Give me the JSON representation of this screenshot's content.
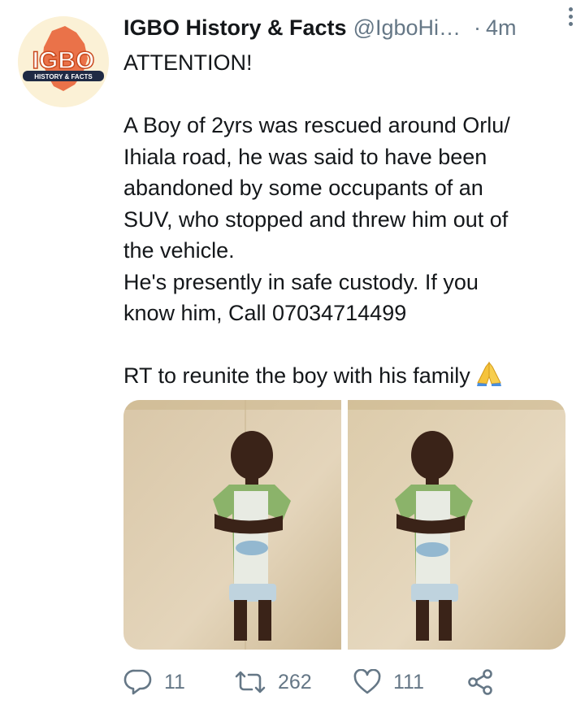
{
  "tweet": {
    "author": {
      "name": "IGBO History & Facts",
      "handle": "@IgboHi…",
      "avatar_logo_text": "IGBO",
      "avatar_logo_subtext": "HISTORY & FACTS"
    },
    "separator": "·",
    "time": "4m",
    "lines": [
      "ATTENTION!",
      "",
      "A Boy of 2yrs was rescued around Orlu/",
      "Ihiala road, he was said to have been",
      "abandoned by some occupants of an",
      "SUV, who stopped and threw him out of",
      "the vehicle.",
      "He's presently in safe custody. If you",
      "know him, Call 07034714499",
      "",
      "RT to reunite the boy with his family"
    ],
    "emoji_icon": "folded-hands-icon",
    "stats": {
      "replies": "11",
      "retweets": "262",
      "likes": "111"
    }
  },
  "colors": {
    "text": "#14171a",
    "muted": "#657786",
    "avatar_orange": "#e8643a",
    "avatar_bg": "#fbf1d6"
  }
}
